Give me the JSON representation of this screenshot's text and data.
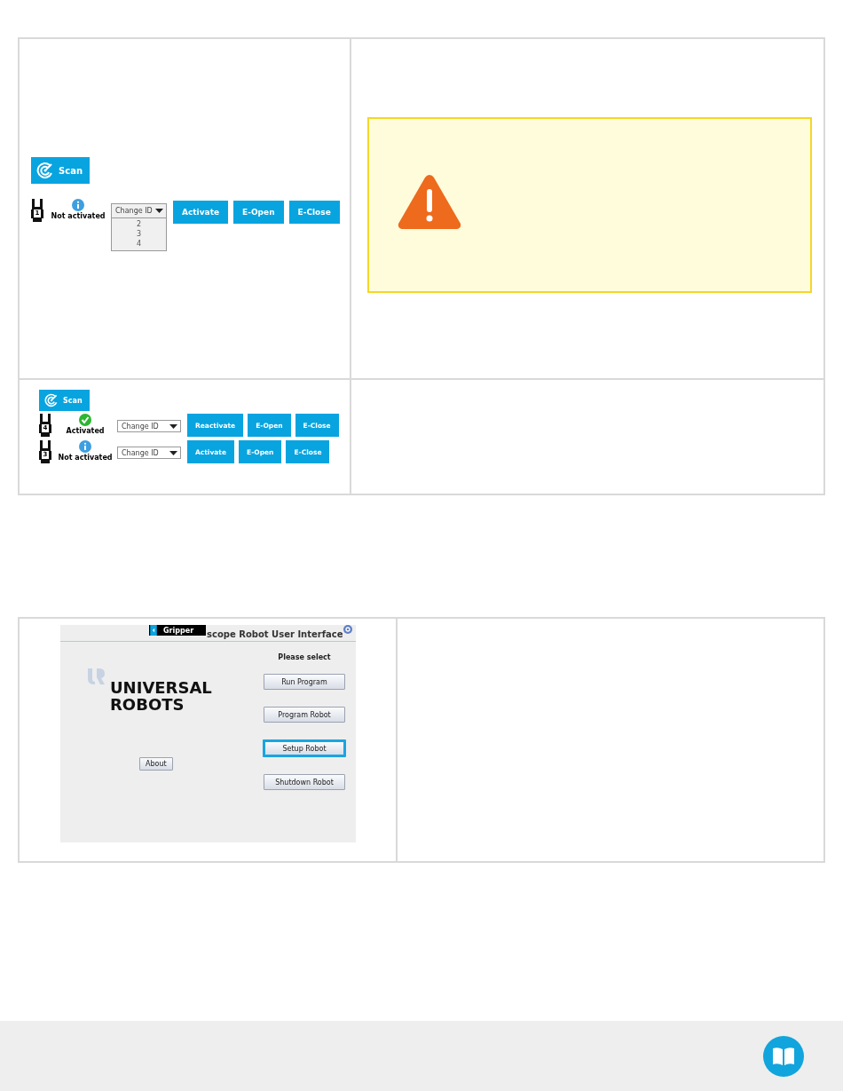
{
  "table_1": {
    "rows": [
      {
        "scan_button": "Scan",
        "grippers": [
          {
            "number": "1",
            "status": {
              "kind": "not_activated",
              "label": "Not activated"
            },
            "dropdown": {
              "value": "Change ID",
              "expanded": true,
              "options": [
                "2",
                "3",
                "4"
              ]
            },
            "buttons": [
              "Activate",
              "E-Open",
              "E-Close"
            ]
          }
        ],
        "warning": {
          "shown": true
        }
      },
      {
        "scan_button": "Scan",
        "grippers": [
          {
            "number": "4",
            "status": {
              "kind": "activated",
              "label": "Activated"
            },
            "dropdown": {
              "value": "Change ID",
              "expanded": false
            },
            "buttons": [
              "Reactivate",
              "E-Open",
              "E-Close"
            ]
          },
          {
            "number": "3",
            "status": {
              "kind": "not_activated",
              "label": "Not activated"
            },
            "dropdown": {
              "value": "Change ID",
              "expanded": false
            },
            "buttons": [
              "Activate",
              "E-Open",
              "E-Close"
            ]
          }
        ]
      }
    ]
  },
  "table_2": {
    "polyscope": {
      "tab_label": "Gripper",
      "title": "scope Robot User Interface",
      "logo_lines": [
        "UNIVERSAL",
        "ROBOTS"
      ],
      "about_button": "About",
      "prompt": "Please select",
      "menu": [
        {
          "label": "Run Program",
          "selected": false
        },
        {
          "label": "Program Robot",
          "selected": false
        },
        {
          "label": "Setup Robot",
          "selected": true
        },
        {
          "label": "Shutdown Robot",
          "selected": false
        }
      ]
    }
  }
}
